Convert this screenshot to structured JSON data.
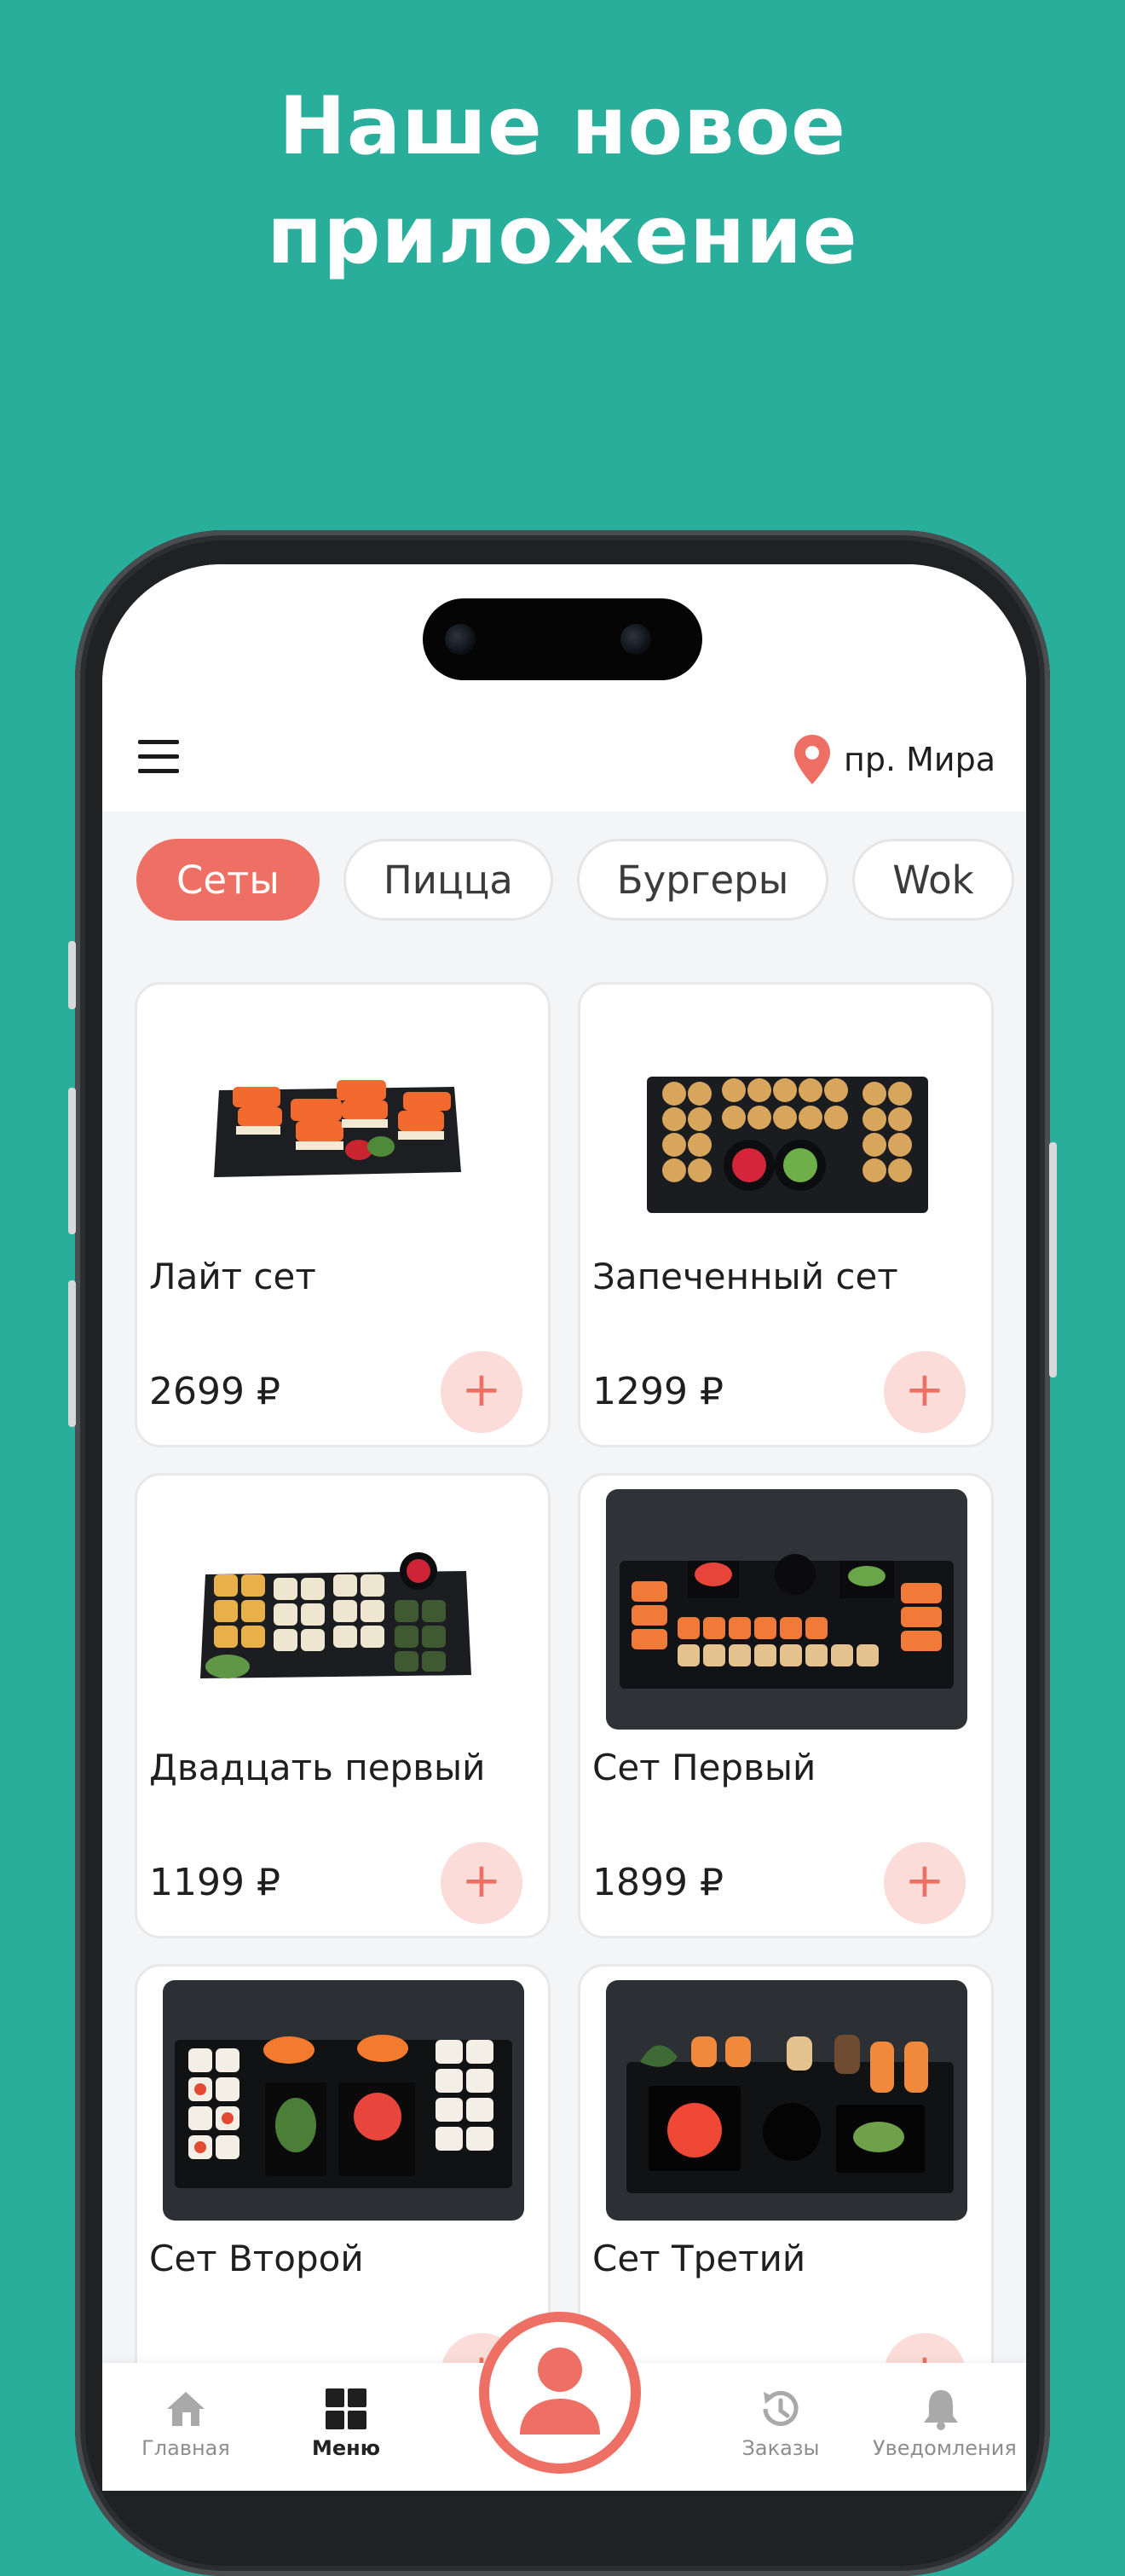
{
  "headline": {
    "line1": "Наше новое",
    "line2": "приложение"
  },
  "appbar": {
    "location": "пр. Мира"
  },
  "categories": [
    {
      "label": "Сеты",
      "active": true
    },
    {
      "label": "Пицца",
      "active": false
    },
    {
      "label": "Бургеры",
      "active": false
    },
    {
      "label": "Wok",
      "active": false
    }
  ],
  "products": [
    {
      "name": "Лайт сет",
      "price": "2699 ₽",
      "add": "+"
    },
    {
      "name": "Запеченный сет",
      "price": "1299 ₽",
      "add": "+"
    },
    {
      "name": "Двадцать первый",
      "price": "1199 ₽",
      "add": "+"
    },
    {
      "name": "Сет Первый",
      "price": "1899 ₽",
      "add": "+"
    },
    {
      "name": "Сет Второй",
      "price": "",
      "add": "+"
    },
    {
      "name": "Сет Третий",
      "price": "",
      "add": "+"
    }
  ],
  "tabbar": {
    "tabs": [
      {
        "label": "Главная",
        "icon": "home-icon"
      },
      {
        "label": "Меню",
        "icon": "grid-icon"
      },
      {
        "label": "Заказы",
        "icon": "history-icon"
      },
      {
        "label": "Уведомления",
        "icon": "bell-icon"
      }
    ],
    "profile_icon": "user-icon"
  },
  "colors": {
    "background": "#2aae9c",
    "accent": "#ee6f63",
    "accent_light": "#fbdcd8"
  }
}
